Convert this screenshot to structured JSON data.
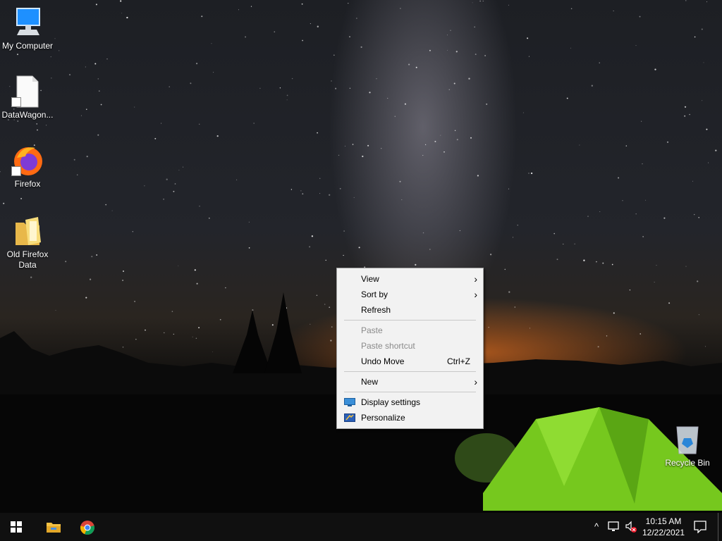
{
  "desktop": {
    "icons": [
      {
        "label": "My Computer",
        "icon": "computer-icon"
      },
      {
        "label": "DataWagon...",
        "icon": "file-shortcut-icon"
      },
      {
        "label": "Firefox",
        "icon": "firefox-icon"
      },
      {
        "label": "Old Firefox Data",
        "icon": "folder-icon"
      },
      {
        "label": "Recycle Bin",
        "icon": "recycle-bin-icon"
      }
    ]
  },
  "context_menu": {
    "items": [
      {
        "label": "View",
        "submenu": true
      },
      {
        "label": "Sort by",
        "submenu": true
      },
      {
        "label": "Refresh"
      },
      {
        "label": "Paste",
        "disabled": true
      },
      {
        "label": "Paste shortcut",
        "disabled": true
      },
      {
        "label": "Undo Move",
        "shortcut": "Ctrl+Z"
      },
      {
        "label": "New",
        "submenu": true
      },
      {
        "label": "Display settings",
        "icon": "display-icon"
      },
      {
        "label": "Personalize",
        "icon": "personalize-icon"
      }
    ],
    "submenu_arrow": "›"
  },
  "taskbar": {
    "start_icon": "windows-start-icon",
    "pinned": [
      "file-explorer-icon",
      "chrome-icon"
    ],
    "tray": {
      "chevron": "^",
      "icons": [
        "network-icon",
        "volume-muted-icon"
      ],
      "time": "10:15 AM",
      "date": "12/22/2021",
      "notification_icon": "action-center-icon"
    }
  },
  "colors": {
    "taskbar": "#101010",
    "menu_bg": "#f2f2f2",
    "tent": "#7ed321"
  }
}
